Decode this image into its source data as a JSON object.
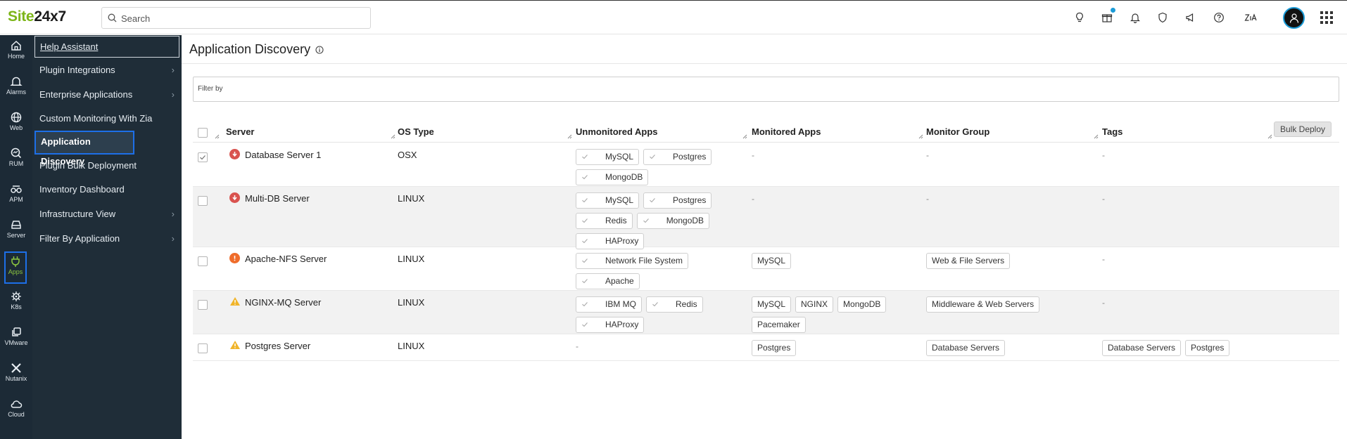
{
  "brand": {
    "part1": "Site",
    "part2": "24x7"
  },
  "search": {
    "placeholder": "Search"
  },
  "rail": [
    {
      "label": "Home",
      "icon": "home-icon"
    },
    {
      "label": "Alarms",
      "icon": "bell-icon"
    },
    {
      "label": "Web",
      "icon": "globe-icon"
    },
    {
      "label": "RUM",
      "icon": "rum-icon"
    },
    {
      "label": "APM",
      "icon": "apm-icon"
    },
    {
      "label": "Server",
      "icon": "server-icon"
    },
    {
      "label": "Apps",
      "icon": "plug-icon"
    },
    {
      "label": "K8s",
      "icon": "helm-icon"
    },
    {
      "label": "VMware",
      "icon": "vmware-icon"
    },
    {
      "label": "Nutanix",
      "icon": "nutanix-icon"
    },
    {
      "label": "Cloud",
      "icon": "cloud-icon"
    }
  ],
  "submenu": [
    {
      "label": "Help Assistant"
    },
    {
      "label": "Plugin Integrations",
      "chevron": "›"
    },
    {
      "label": "Enterprise Applications",
      "chevron": "›"
    },
    {
      "label": "Custom Monitoring With Zia"
    },
    {
      "label": "Application Discovery"
    },
    {
      "label": "Plugin Bulk Deployment"
    },
    {
      "label": "Inventory Dashboard"
    },
    {
      "label": "Infrastructure View",
      "chevron": "›"
    },
    {
      "label": "Filter By Application",
      "chevron": "›"
    }
  ],
  "page": {
    "title": "Application Discovery",
    "filter_placeholder": "Filter by",
    "bulk_deploy": "Bulk Deploy"
  },
  "columns": [
    "Server",
    "OS Type",
    "Unmonitored Apps",
    "Monitored Apps",
    "Monitor Group",
    "Tags"
  ],
  "rows": [
    {
      "server": "Database Server 1",
      "status": "down",
      "os": "OSX",
      "checked": true,
      "unmonitored": [
        "MySQL",
        "Postgres",
        "MongoDB"
      ],
      "monitored": [],
      "group": [],
      "tags": [],
      "dash": "-"
    },
    {
      "server": "Multi-DB Server",
      "status": "down",
      "os": "LINUX",
      "checked": false,
      "unmonitored": [
        "MySQL",
        "Postgres",
        "Redis",
        "MongoDB",
        "HAProxy"
      ],
      "monitored": [],
      "group": [],
      "tags": [],
      "dash": "-"
    },
    {
      "server": "Apache-NFS Server",
      "status": "critical",
      "os": "LINUX",
      "checked": false,
      "unmonitored": [
        "Network File System",
        "Apache"
      ],
      "monitored": [
        "MySQL"
      ],
      "group": [
        "Web & File Servers"
      ],
      "tags": [],
      "dash": "-"
    },
    {
      "server": "NGINX-MQ Server",
      "status": "warning",
      "os": "LINUX",
      "checked": false,
      "unmonitored": [
        "IBM MQ",
        "Redis",
        "HAProxy"
      ],
      "monitored": [
        "MySQL",
        "NGINX",
        "MongoDB",
        "Pacemaker"
      ],
      "group": [
        "Middleware & Web Servers"
      ],
      "tags": [],
      "dash": "-"
    },
    {
      "server": "Postgres Server",
      "status": "warning",
      "os": "LINUX",
      "checked": false,
      "unmonitored": [],
      "monitored": [
        "Postgres"
      ],
      "group": [
        "Database Servers"
      ],
      "tags": [
        "Database Servers",
        "Postgres"
      ],
      "dash": "-"
    }
  ]
}
